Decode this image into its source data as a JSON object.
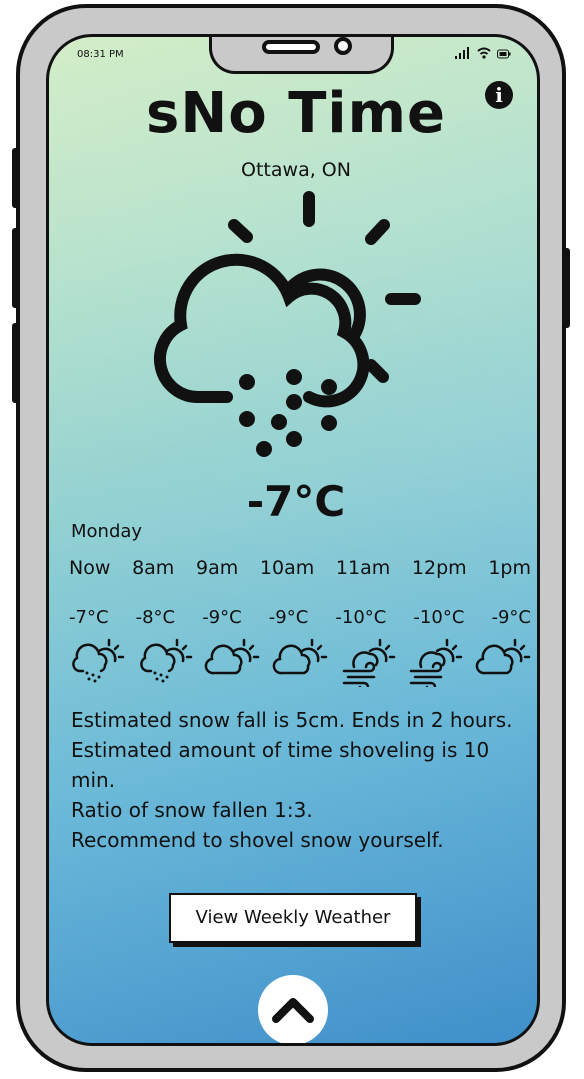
{
  "status_bar": {
    "time": "08:31 PM"
  },
  "app": {
    "title": "sNo Time",
    "location": "Ottawa, ON"
  },
  "current": {
    "temperature": "-7°C",
    "icon": "snow-cloud-sun-icon"
  },
  "forecast": {
    "day": "Monday",
    "hours": [
      "Now",
      "8am",
      "9am",
      "10am",
      "11am",
      "12pm",
      "1pm"
    ],
    "temps": [
      "-7°C",
      "-8°C",
      "-9°C",
      "-9°C",
      "-10°C",
      "-10°C",
      "-9°C"
    ],
    "icons": [
      "snow-cloud-sun-icon",
      "snow-cloud-sun-icon",
      "cloud-sun-icon",
      "cloud-sun-icon",
      "wind-cloud-sun-icon",
      "wind-cloud-sun-icon",
      "cloud-sun-icon"
    ]
  },
  "info": [
    "Estimated snow fall is 5cm. Ends in 2 hours.",
    "Estimated amount of time shoveling is 10 min.",
    "Ratio of snow fallen 1:3.",
    "Recommend to shovel snow yourself."
  ],
  "buttons": {
    "weekly_label": "View Weekly Weather",
    "info_icon": "info-icon",
    "up_icon": "chevron-up-icon"
  }
}
